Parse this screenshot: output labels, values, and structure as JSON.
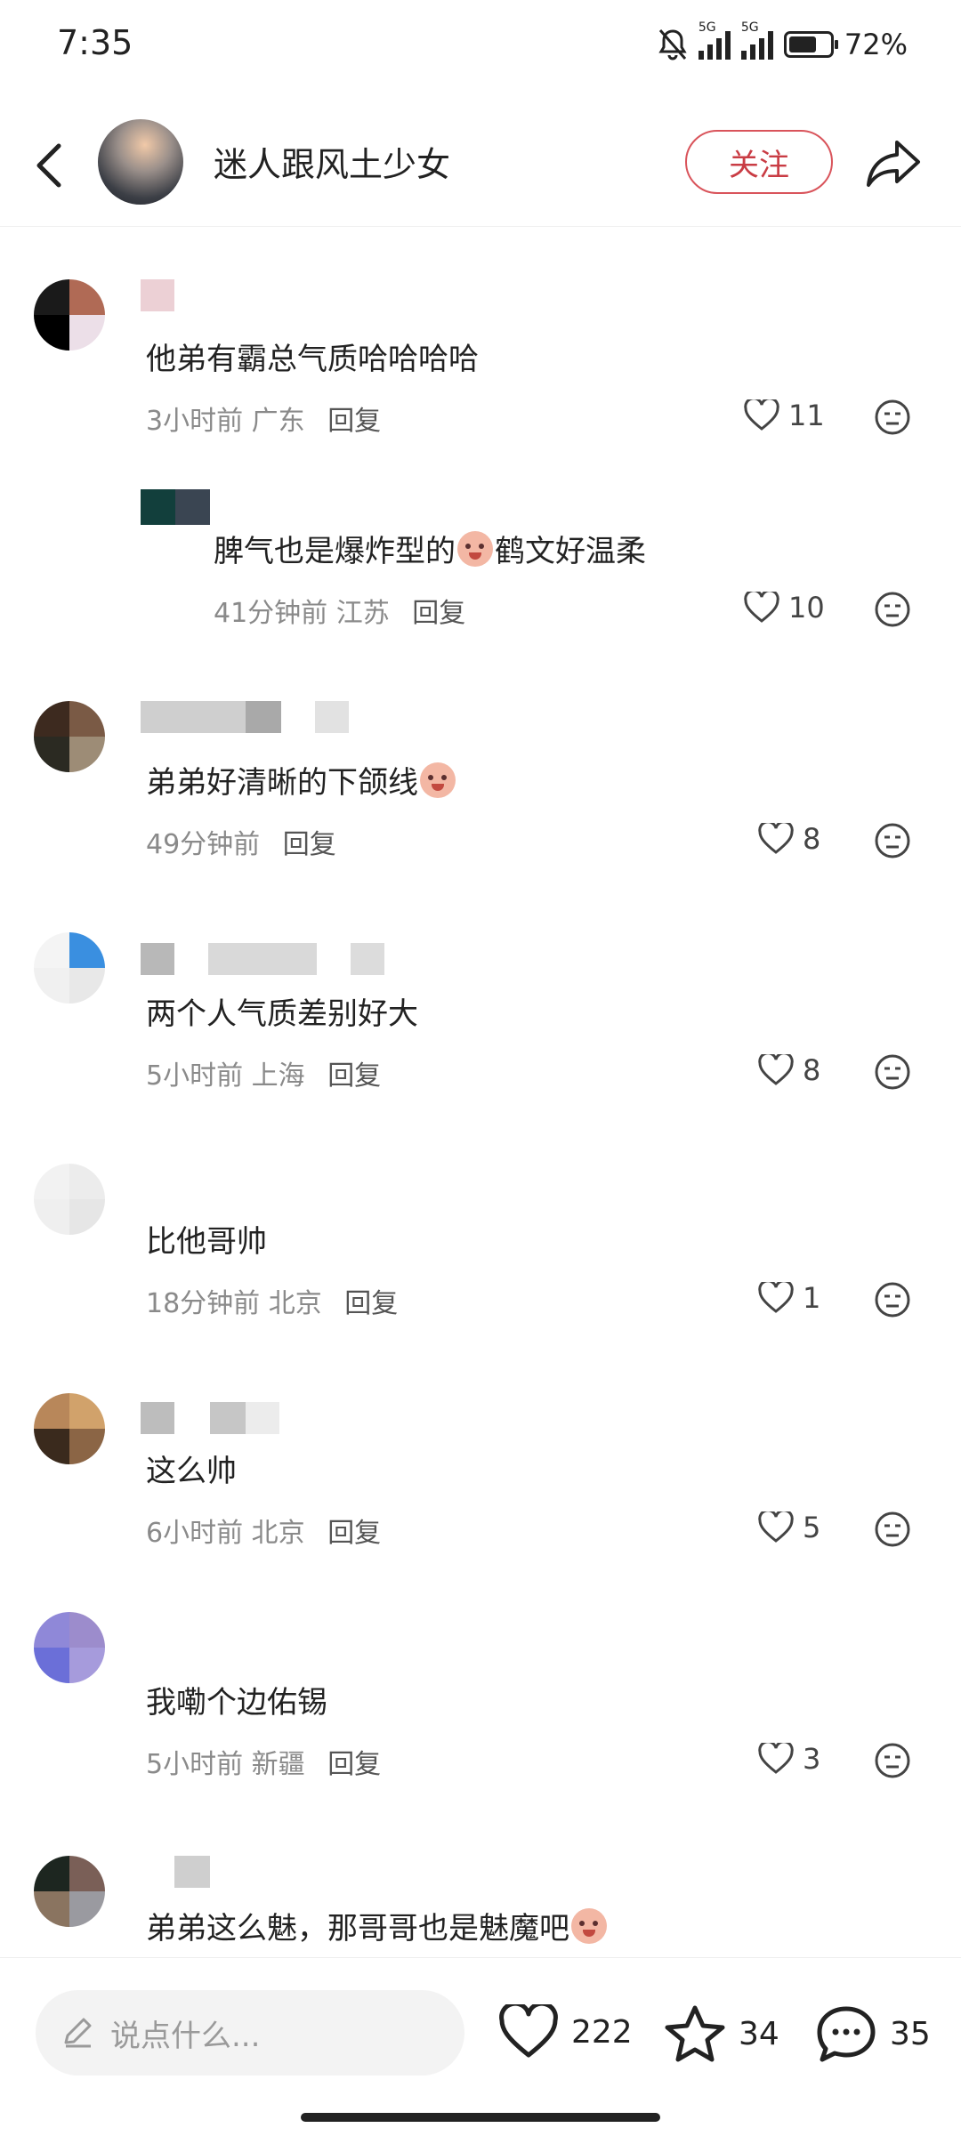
{
  "status": {
    "time": "7:35",
    "signal_label": "5G",
    "battery": "72%"
  },
  "header": {
    "title": "迷人跟风土少女",
    "follow_label": "关注"
  },
  "comments": [
    {
      "text_before": "他弟有霸总气质哈哈哈哈",
      "text_after": "",
      "emoji_inline": false,
      "time": "3小时前",
      "location": "广东",
      "reply": "回复",
      "likes": "11"
    },
    {
      "text_before": "脾气也是爆炸型的",
      "text_after": "鹤文好温柔",
      "emoji_inline": true,
      "time": "41分钟前",
      "location": "江苏",
      "reply": "回复",
      "likes": "10"
    },
    {
      "text_before": "弟弟好清晰的下颌线",
      "text_after": "",
      "emoji_inline": true,
      "time": "49分钟前",
      "location": "",
      "reply": "回复",
      "likes": "8"
    },
    {
      "text_before": "两个人气质差别好大",
      "text_after": "",
      "emoji_inline": false,
      "time": "5小时前",
      "location": "上海",
      "reply": "回复",
      "likes": "8"
    },
    {
      "text_before": "比他哥帅",
      "text_after": "",
      "emoji_inline": false,
      "time": "18分钟前",
      "location": "北京",
      "reply": "回复",
      "likes": "1"
    },
    {
      "text_before": "这么帅",
      "text_after": "",
      "emoji_inline": false,
      "time": "6小时前",
      "location": "北京",
      "reply": "回复",
      "likes": "5"
    },
    {
      "text_before": "我嘞个边佑锡",
      "text_after": "",
      "emoji_inline": false,
      "time": "5小时前",
      "location": "新疆",
      "reply": "回复",
      "likes": "3"
    },
    {
      "text_before": "弟弟这么魅，那哥哥也是魅魔吧",
      "text_after": "",
      "emoji_inline": true
    }
  ],
  "bottom": {
    "placeholder": "说点什么...",
    "likes": "222",
    "favorites": "34",
    "comments": "35"
  },
  "colors": {
    "accent": "#c93c44",
    "text": "#222222",
    "meta": "#8a8a8a"
  }
}
